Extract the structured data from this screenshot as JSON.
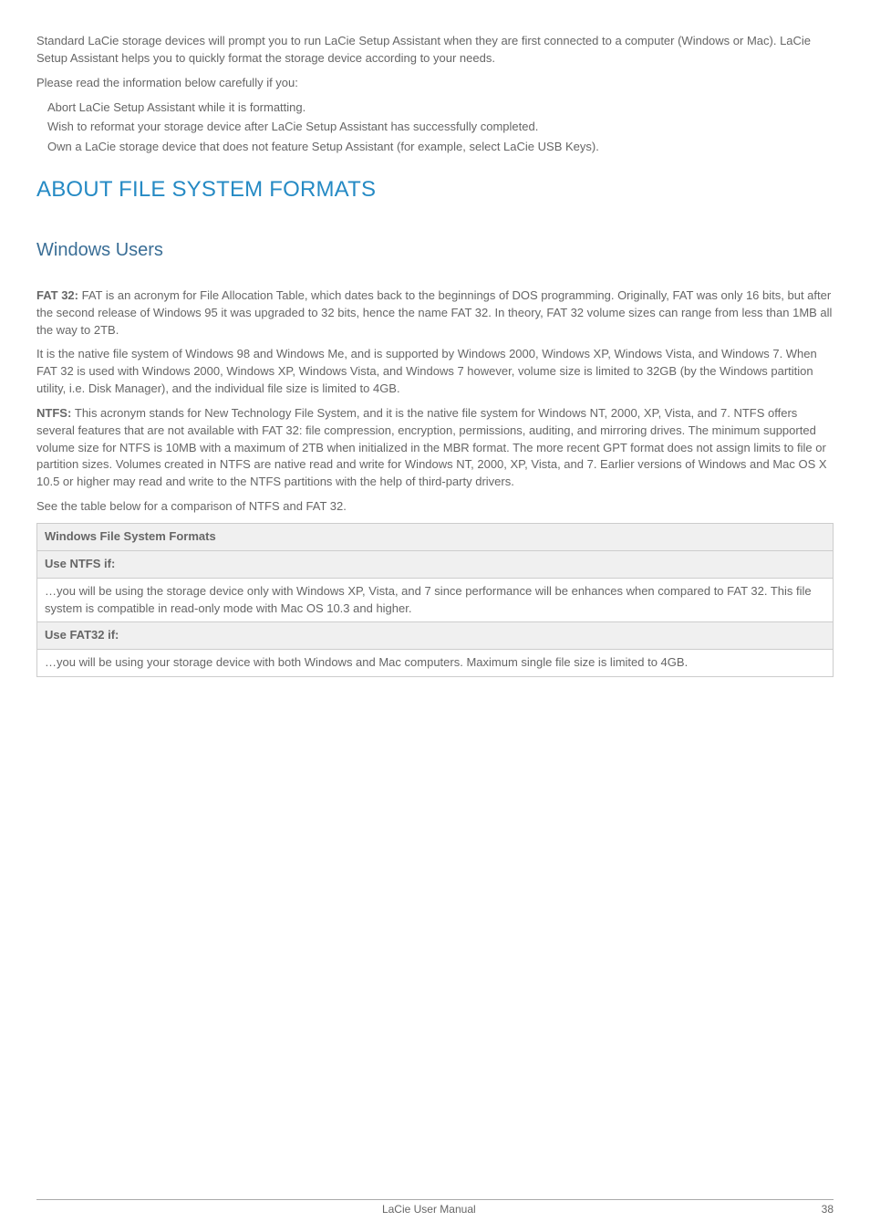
{
  "intro": {
    "p1": "Standard LaCie storage devices will prompt you to run LaCie Setup Assistant when they are first connected to a computer (Windows or Mac). LaCie Setup Assistant helps you to quickly format the storage device according to your needs.",
    "p2": "Please read the information below carefully if you:",
    "bullets": [
      "Abort LaCie Setup Assistant while it is formatting.",
      "Wish to reformat your storage device after LaCie Setup Assistant has successfully completed.",
      "Own a LaCie storage device that does not feature Setup Assistant (for example, select LaCie USB Keys)."
    ]
  },
  "section": {
    "title": "ABOUT FILE SYSTEM FORMATS",
    "subsection_title": "Windows Users",
    "fat32_label": "FAT 32: ",
    "fat32_p1": "FAT is an acronym for File Allocation Table, which dates back to the beginnings of DOS programming. Originally, FAT was only 16 bits, but after the second release of Windows 95 it was upgraded to 32 bits, hence the name FAT 32. In theory, FAT 32 volume sizes can range from less than 1MB all the way to 2TB.",
    "fat32_p2": "It is the native file system of Windows 98 and Windows Me, and is supported by Windows 2000, Windows XP, Windows Vista, and Windows 7. When FAT 32 is used with Windows 2000, Windows XP, Windows Vista, and Windows 7 however, volume size is limited to 32GB (by the Windows partition utility, i.e. Disk Manager), and the individual file size is limited to 4GB.",
    "ntfs_label": "NTFS: ",
    "ntfs_p1": "This acronym stands for New Technology File System, and it is the native file system for Windows NT, 2000, XP, Vista, and 7. NTFS offers several features that are not available with FAT 32: file compression, encryption, permissions, auditing, and mirroring drives. The minimum supported volume size for NTFS is 10MB with a maximum of 2TB when initialized in the MBR format. The more recent GPT format does not assign limits to file or partition sizes. Volumes created in NTFS are native read and write for Windows NT, 2000, XP, Vista, and 7. Earlier versions of Windows and Mac OS X 10.5 or higher may read and write to the NTFS partitions with the help of third-party drivers.",
    "compare_line": "See the table below for a comparison of NTFS and FAT 32."
  },
  "table": {
    "header": "Windows File System Formats",
    "row1_head": "Use NTFS if:",
    "row1_body": "…you will be using the storage device only with Windows XP, Vista, and 7 since performance will be enhances when compared to FAT 32. This file system is compatible in read-only mode with Mac OS 10.3 and higher.",
    "row2_head": "Use FAT32 if:",
    "row2_body": "…you will be using your storage device with both Windows and Mac computers. Maximum single file size is limited to 4GB."
  },
  "footer": {
    "center": "LaCie User Manual",
    "page": "38"
  }
}
